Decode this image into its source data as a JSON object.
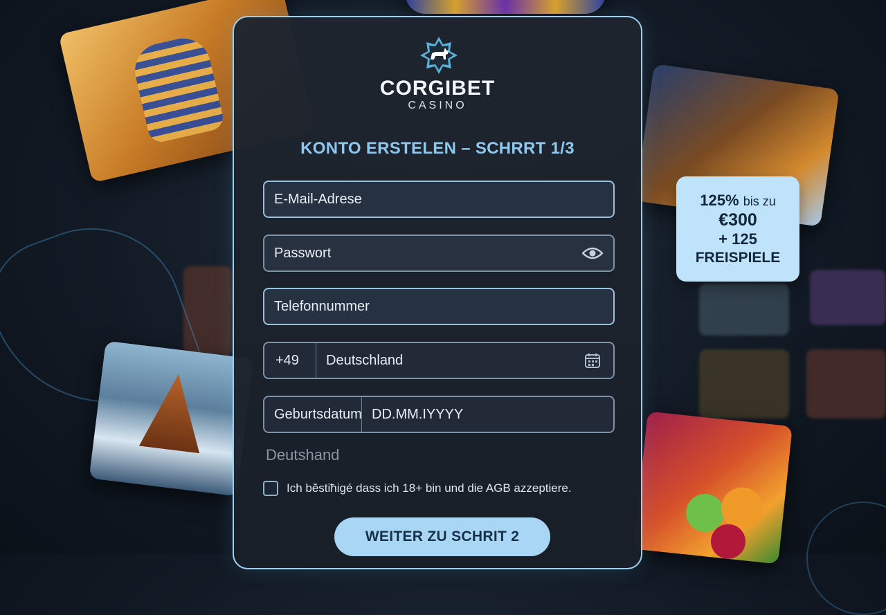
{
  "brand": {
    "name": "CORGIBET",
    "sub": "CASINO"
  },
  "form": {
    "title": "KONTO ERSTELEN – SCHRRT 1/3",
    "email_placeholder": "E-Mail-Adrese",
    "password_placeholder": "Passwort",
    "phone_placeholder": "Telefonnummer",
    "country_code": "+49",
    "country": "Deutschland",
    "birthdate_label": "Geburtsdatum",
    "birthdate_placeholder": "DD.MM.IYYYY",
    "country_text": "Deutshand",
    "terms_label": "Ich bĕstiħigé dass ich 18+ bin und die AGB azzeptiere.",
    "terms_checked": false,
    "submit_label": "WEITER ZU SCHRIT 2"
  },
  "promo": {
    "percent": "125%",
    "bis_zu": "bis zu",
    "amount": "€300",
    "spins": "+ 125",
    "spins_label": "FREISPIELE"
  },
  "colors": {
    "accent": "#9bd0f2",
    "title": "#8ec8f0",
    "button_bg": "#a9d6f4",
    "promo_bg": "#bfe3fb"
  },
  "icons": {
    "logo": "corgi-star-logo-icon",
    "password_toggle": "eye-icon",
    "country_picker": "calendar-icon"
  }
}
